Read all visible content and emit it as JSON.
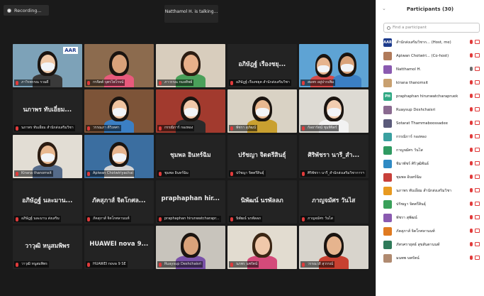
{
  "meeting": {
    "recording_label": "Recording...",
    "talking_label": "Natthamol H. is talking..."
  },
  "tiles": [
    {
      "type": "video",
      "name": "ภาวิรพรรณ รวมดี",
      "bg": "#7da2b8",
      "skin": "#f0c9a8",
      "hair": "#1a1410",
      "shirt": "#3a3a3a",
      "mask": true,
      "extra": "AAR"
    },
    {
      "type": "video",
      "name": "กรจิตต์ บุตรไพโรจน์",
      "bg": "#8c6b4e",
      "skin": "#d9a27a",
      "hair": "#1a1410",
      "shirt": "#e85a7c",
      "mask": false
    },
    {
      "type": "video",
      "name": "ภาวรรณ กมลทิพย์",
      "bg": "#d8cdbd",
      "skin": "#e8b08a",
      "hair": "#2b1c12",
      "shirt": "#4aa05a",
      "mask": false
    },
    {
      "type": "text",
      "big": "อภิษัฎฐ์ เรืองชยุ...",
      "name": "อภิษัฎฐ์ เรืองชยุต สำนักส่งเสริมวิชา"
    },
    {
      "type": "video",
      "name": "สมพร อยู่ปากเพิ่ม",
      "bg": "#5ea3d4",
      "skin": "#e6b48e",
      "hair": "#1a1410",
      "shirt": "#d44a4a",
      "mask": true,
      "two": true
    },
    {
      "type": "text",
      "big": "นภาพร ทับเอี่ยม...",
      "name": "นภาพร ทับเอี่ยม สำนักส่งเสริมวิชา"
    },
    {
      "type": "video",
      "name": "วรรณภา ดีวิเทศา",
      "bg": "#7d5438",
      "skin": "#f0c4a0",
      "hair": "#1a1410",
      "shirt": "#3b7fc4",
      "mask": true
    },
    {
      "type": "video",
      "name": "กรรณิการ์ กองทอง",
      "bg": "#a23a2e",
      "skin": "#f0c8aa",
      "hair": "#1a1410",
      "shirt": "#2a2a2a",
      "mask": true
    },
    {
      "type": "video",
      "name": "พัชรา สุภัฒน์",
      "bg": "#d9d2c4",
      "skin": "#e8b890",
      "hair": "#1a1410",
      "shirt": "#c9a030",
      "mask": true
    },
    {
      "type": "video",
      "name": "กัลยารัตน์ ชุมพิจิตร์",
      "bg": "#dddad3",
      "skin": "#f2cdb0",
      "hair": "#1a1410",
      "shirt": "#f2f2f2",
      "mask": true
    },
    {
      "type": "video",
      "name": "Kirana thanomsit",
      "bg": "#e2ddd4",
      "skin": "#e8b890",
      "hair": "#2b1c12",
      "shirt": "#556b8a",
      "mask": true
    },
    {
      "type": "video",
      "name": "Apiwan Chotwiriyachai",
      "bg": "#3b6ea0",
      "skin": "#e6b48e",
      "hair": "#1a1410",
      "shirt": "#d4d4d4",
      "mask": true,
      "active": true
    },
    {
      "type": "text",
      "big": "ชุมพล อินทร์ฉิม",
      "name": "ชุมพล อินทร์ฉิม"
    },
    {
      "type": "text",
      "big": "ปรัชญา จิตตรีสินธุ์",
      "name": "ปรัชญา จิตตรีสินธุ์"
    },
    {
      "type": "text",
      "big": "ศิริพัชรา นารี_สำ...",
      "name": "ศิริพัชรา นารี_สำนักส่งเสริมวิชาการฯ"
    },
    {
      "type": "text",
      "big": "อภิษัฎฐ์ นละมาน...",
      "name": "อภิษัฎฐ์ นละมาน ส่งเสริม"
    },
    {
      "type": "text",
      "big": "ภัคสุภาส์ จิตโกศล...",
      "name": "ภัคสุภาส์ จิตโกศลานนท์"
    },
    {
      "type": "text",
      "big": "praphaphan hir...",
      "name": "praphaphan hirunwatcharapr..."
    },
    {
      "type": "text",
      "big": "นิพัฒน์ นรพัลลภ",
      "name": "นิพัฒน์ นรพัลลภ"
    },
    {
      "type": "text",
      "big": "ภาญจมัศร วันไส",
      "name": "ภาญจมัศร วันไส"
    },
    {
      "type": "text",
      "big": "วาวุฒิ หนูสมพิพร",
      "name": "วาวุฒิ หนูสมพิพร"
    },
    {
      "type": "text",
      "big": "HUAWEI nova 9...",
      "name": "HUAWEI nova 9 SE"
    },
    {
      "type": "video",
      "name": "Ruaysup Deshchaisri",
      "bg": "#c8c4bc",
      "skin": "#d9a27a",
      "hair": "#1a1410",
      "shirt": "#7a52a8",
      "mask": false
    },
    {
      "type": "video",
      "name": "นภพร นพรัตน์",
      "bg": "#e2dcd0",
      "skin": "#f0c8aa",
      "hair": "#3b2614",
      "shirt": "#d44a7a",
      "mask": false
    },
    {
      "type": "video",
      "name": "วรรณวลี สุวรรณ์",
      "bg": "#d8d4cc",
      "skin": "#e6b48e",
      "hair": "#1a1410",
      "shirt": "#c84030",
      "mask": false
    }
  ],
  "panel": {
    "title": "Participants (30)",
    "search_placeholder": "Find a participant",
    "participants": [
      {
        "name": "สำนักส่งเสริมวิชาก... (Host, me)",
        "avatar_text": "AAR",
        "avatar_color": "#1d3b8c",
        "mic_on": false
      },
      {
        "name": "Apiwan Chotwiri... (Co-host)",
        "avatar_text": "",
        "avatar_color": "#b07a5a",
        "mic_on": false
      },
      {
        "name": "Natthamol H.",
        "avatar_text": "",
        "avatar_color": "#8a5ab0",
        "mic_on": true
      },
      {
        "name": "kirana thanomsit",
        "avatar_text": "",
        "avatar_color": "#c8a070",
        "mic_on": false
      },
      {
        "name": "praphaphan hirunwatcharapruek",
        "avatar_text": "PH",
        "avatar_color": "#2fa883",
        "mic_on": false
      },
      {
        "name": "Ruaysup Deshchaisri",
        "avatar_text": "",
        "avatar_color": "#8a6a90",
        "mic_on": false
      },
      {
        "name": "Sotarat Thammaboossadee",
        "avatar_text": "",
        "avatar_color": "#5a5a7a",
        "mic_on": false
      },
      {
        "name": "กรรณิการ์ กองทอง",
        "avatar_text": "",
        "avatar_color": "#3aa0a0",
        "mic_on": false
      },
      {
        "name": "กาญจมัศร วันไส",
        "avatar_text": "",
        "avatar_color": "#2f9a62",
        "mic_on": false
      },
      {
        "name": "ชิมาพัชร์ ศิริวุฒิพันธ์",
        "avatar_text": "",
        "avatar_color": "#2f8ac4",
        "mic_on": false
      },
      {
        "name": "ชุมพล อินทร์ฉิม",
        "avatar_text": "",
        "avatar_color": "#c8403a",
        "mic_on": false
      },
      {
        "name": "นภาพร ทับเอี่ยม สำนักส่งเสริมวิชา",
        "avatar_text": "",
        "avatar_color": "#e89a20",
        "mic_on": false
      },
      {
        "name": "ปรัชญา จิตตรีสินธุ์",
        "avatar_text": "",
        "avatar_color": "#3aa05a",
        "mic_on": false
      },
      {
        "name": "พัชรา สุพัฒน์",
        "avatar_text": "",
        "avatar_color": "#8a5ab0",
        "mic_on": false
      },
      {
        "name": "ภัคสุภาส์ จิตโกศลานนท์",
        "avatar_text": "",
        "avatar_color": "#e07a20",
        "mic_on": false
      },
      {
        "name": "ภัทรศรายุทธ์ สุขสันตานนท์",
        "avatar_text": "",
        "avatar_color": "#2f7a5a",
        "mic_on": false
      },
      {
        "name": "มนทพ นพรัตน์",
        "avatar_text": "",
        "avatar_color": "#b08a70",
        "mic_on": false
      }
    ]
  },
  "colors": {
    "accent_active": "#2ea043",
    "muted_red": "#e03b3b"
  }
}
